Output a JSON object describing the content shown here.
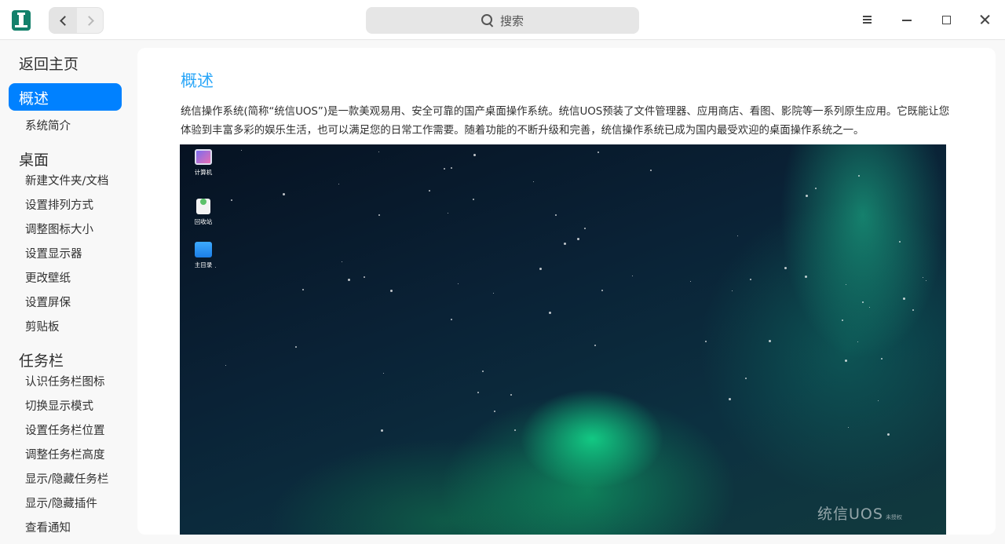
{
  "titlebar": {
    "search_placeholder": "搜索",
    "icons": [
      "app-lighthouse-icon",
      "chevron-left-icon",
      "chevron-right-icon",
      "search-icon",
      "menu-icon",
      "minimize-icon",
      "maximize-icon",
      "close-icon"
    ]
  },
  "sidebar": {
    "back_home": "返回主页",
    "active_item": "概述",
    "items": [
      {
        "type": "sub",
        "label": "系统简介"
      },
      {
        "type": "section",
        "label": "桌面"
      },
      {
        "type": "sub",
        "label": "新建文件夹/文档"
      },
      {
        "type": "sub",
        "label": "设置排列方式"
      },
      {
        "type": "sub",
        "label": "调整图标大小"
      },
      {
        "type": "sub",
        "label": "设置显示器"
      },
      {
        "type": "sub",
        "label": "更改壁纸"
      },
      {
        "type": "sub",
        "label": "设置屏保"
      },
      {
        "type": "sub",
        "label": "剪贴板"
      },
      {
        "type": "section",
        "label": "任务栏"
      },
      {
        "type": "sub",
        "label": "认识任务栏图标"
      },
      {
        "type": "sub",
        "label": "切换显示模式"
      },
      {
        "type": "sub",
        "label": "设置任务栏位置"
      },
      {
        "type": "sub",
        "label": "调整任务栏高度"
      },
      {
        "type": "sub",
        "label": "显示/隐藏任务栏"
      },
      {
        "type": "sub",
        "label": "显示/隐藏插件"
      },
      {
        "type": "sub",
        "label": "查看通知"
      }
    ]
  },
  "content": {
    "title": "概述",
    "intro": "统信操作系统(简称“统信UOS”)是一款美观易用、安全可靠的国产桌面操作系统。统信UOS预装了文件管理器、应用商店、看图、影院等一系列原生应用。它既能让您体验到丰富多彩的娱乐生活，也可以满足您的日常工作需要。随着功能的不断升级和完善，统信操作系统已成为国内最受欢迎的桌面操作系统之一。",
    "desktop": {
      "icons": [
        {
          "label": "计算机"
        },
        {
          "label": "回收站"
        },
        {
          "label": "主目录"
        }
      ],
      "watermark": "统信UOS",
      "watermark_badge": "未授权"
    }
  },
  "colors": {
    "accent": "#0081ff",
    "title_blue": "#2ca7f8",
    "aurora_green": "#14f096"
  }
}
